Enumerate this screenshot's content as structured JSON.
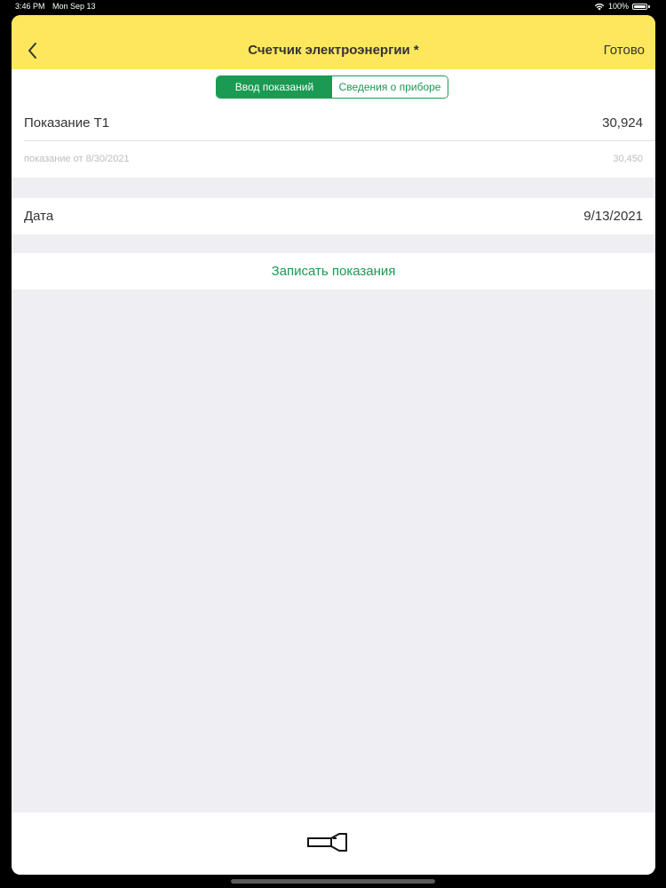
{
  "status_bar": {
    "time": "3:46 PM",
    "date": "Mon Sep 13",
    "battery": "100%"
  },
  "navbar": {
    "title": "Счетчик электроэнергии *",
    "done_label": "Готово",
    "background_color": "#fde75c"
  },
  "segments": {
    "active_label": "Ввод показаний",
    "inactive_label": "Сведения о приборе",
    "accent_color": "#1a9a52"
  },
  "reading": {
    "label": "Показание Т1",
    "value": "30,924",
    "previous_label": "показание от 8/30/2021",
    "previous_value": "30,450"
  },
  "date_field": {
    "label": "Дата",
    "value": "9/13/2021"
  },
  "action": {
    "label": "Записать показания"
  },
  "bottom_bar": {
    "icon": "flashlight-icon"
  }
}
